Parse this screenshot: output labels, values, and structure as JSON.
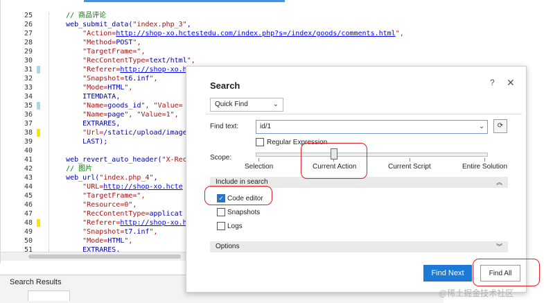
{
  "editor": {
    "lines": [
      {
        "n": "25",
        "mark": "none",
        "segs": [
          {
            "t": "    ",
            "c": "k"
          },
          {
            "t": "// 商品评论",
            "c": "c"
          }
        ]
      },
      {
        "n": "26",
        "mark": "none",
        "segs": [
          {
            "t": "    web_submit_data(",
            "c": "k"
          },
          {
            "t": "\"index.php_3\"",
            "c": "s"
          },
          {
            "t": ",",
            "c": "k"
          }
        ]
      },
      {
        "n": "27",
        "mark": "none",
        "segs": [
          {
            "t": "        \"Action=",
            "c": "s"
          },
          {
            "t": "http://shop-xo.hctestedu.com/index.php?s=/index/goods/comments.html",
            "c": "u"
          },
          {
            "t": "\",",
            "c": "s"
          }
        ]
      },
      {
        "n": "28",
        "mark": "none",
        "segs": [
          {
            "t": "        \"Method=",
            "c": "s"
          },
          {
            "t": "POST",
            "c": "k"
          },
          {
            "t": "\",",
            "c": "s"
          }
        ]
      },
      {
        "n": "29",
        "mark": "none",
        "segs": [
          {
            "t": "        \"TargetFrame=\",",
            "c": "s"
          }
        ]
      },
      {
        "n": "30",
        "mark": "none",
        "segs": [
          {
            "t": "        \"RecContentType=",
            "c": "s"
          },
          {
            "t": "text/html",
            "c": "k"
          },
          {
            "t": "\",",
            "c": "s"
          }
        ]
      },
      {
        "n": "31",
        "mark": "cyan",
        "segs": [
          {
            "t": "        \"Referer=",
            "c": "s"
          },
          {
            "t": "http://shop-xo.h",
            "c": "u"
          }
        ]
      },
      {
        "n": "32",
        "mark": "none",
        "segs": [
          {
            "t": "        \"Snapshot=",
            "c": "s"
          },
          {
            "t": "t6.inf",
            "c": "k"
          },
          {
            "t": "\",",
            "c": "s"
          }
        ]
      },
      {
        "n": "33",
        "mark": "none",
        "segs": [
          {
            "t": "        \"Mode=",
            "c": "s"
          },
          {
            "t": "HTML",
            "c": "k"
          },
          {
            "t": "\",",
            "c": "s"
          }
        ]
      },
      {
        "n": "34",
        "mark": "none",
        "segs": [
          {
            "t": "        ITEMDATA,",
            "c": "k"
          }
        ]
      },
      {
        "n": "35",
        "mark": "cyan",
        "segs": [
          {
            "t": "        \"Name=",
            "c": "s"
          },
          {
            "t": "goods_id",
            "c": "k"
          },
          {
            "t": "\", \"Value=",
            "c": "s"
          }
        ]
      },
      {
        "n": "36",
        "mark": "none",
        "segs": [
          {
            "t": "        \"Name=",
            "c": "s"
          },
          {
            "t": "page",
            "c": "k"
          },
          {
            "t": "\", \"Value=1\",",
            "c": "s"
          }
        ]
      },
      {
        "n": "37",
        "mark": "none",
        "segs": [
          {
            "t": "        EXTRARES,",
            "c": "k"
          }
        ]
      },
      {
        "n": "38",
        "mark": "yellow",
        "segs": [
          {
            "t": "        \"Url=",
            "c": "s"
          },
          {
            "t": "/static/upload/image",
            "c": "k"
          }
        ]
      },
      {
        "n": "39",
        "mark": "none",
        "segs": [
          {
            "t": "        LAST);",
            "c": "k"
          }
        ]
      },
      {
        "n": "40",
        "mark": "none",
        "segs": [
          {
            "t": "",
            "c": "k"
          }
        ]
      },
      {
        "n": "41",
        "mark": "none",
        "segs": [
          {
            "t": "    web_revert_auto_header(",
            "c": "k"
          },
          {
            "t": "\"X-Rec",
            "c": "s"
          }
        ]
      },
      {
        "n": "42",
        "mark": "none",
        "segs": [
          {
            "t": "    ",
            "c": "k"
          },
          {
            "t": "// 图片",
            "c": "c"
          }
        ]
      },
      {
        "n": "43",
        "mark": "none",
        "segs": [
          {
            "t": "    web_url(",
            "c": "k"
          },
          {
            "t": "\"index.php_4\"",
            "c": "s"
          },
          {
            "t": ",",
            "c": "k"
          }
        ]
      },
      {
        "n": "44",
        "mark": "none",
        "segs": [
          {
            "t": "        \"URL=",
            "c": "s"
          },
          {
            "t": "http://shop-xo.hcte",
            "c": "u"
          }
        ]
      },
      {
        "n": "45",
        "mark": "none",
        "segs": [
          {
            "t": "        \"TargetFrame=\",",
            "c": "s"
          }
        ]
      },
      {
        "n": "46",
        "mark": "none",
        "segs": [
          {
            "t": "        \"Resource=0\",",
            "c": "s"
          }
        ]
      },
      {
        "n": "47",
        "mark": "none",
        "segs": [
          {
            "t": "        \"RecContentType=",
            "c": "s"
          },
          {
            "t": "applicat",
            "c": "k"
          }
        ]
      },
      {
        "n": "48",
        "mark": "yellow",
        "segs": [
          {
            "t": "        \"Referer=",
            "c": "s"
          },
          {
            "t": "http://shop-xo.h",
            "c": "u"
          }
        ]
      },
      {
        "n": "49",
        "mark": "none",
        "segs": [
          {
            "t": "        \"Snapshot=",
            "c": "s"
          },
          {
            "t": "t7.inf",
            "c": "k"
          },
          {
            "t": "\",",
            "c": "s"
          }
        ]
      },
      {
        "n": "50",
        "mark": "none",
        "segs": [
          {
            "t": "        \"Mode=",
            "c": "s"
          },
          {
            "t": "HTML",
            "c": "k"
          },
          {
            "t": "\",",
            "c": "s"
          }
        ]
      },
      {
        "n": "51",
        "mark": "none",
        "segs": [
          {
            "t": "        EXTRARES,",
            "c": "k"
          }
        ]
      }
    ]
  },
  "results_panel": {
    "title": "Search Results"
  },
  "dialog": {
    "title": "Search",
    "help": "?",
    "close": "✕",
    "mode_select": "Quick Find",
    "find_label": "Find text:",
    "find_value": "id/1",
    "regex_label": "Regular Expression",
    "scope_label": "Scope:",
    "scope_options": [
      "Selection",
      "Current Action",
      "Current Script",
      "Entire Solution"
    ],
    "include_header": "Include in search",
    "include_items": [
      {
        "label": "Code editor",
        "checked": true
      },
      {
        "label": "Snapshots",
        "checked": false
      },
      {
        "label": "Logs",
        "checked": false
      }
    ],
    "options_header": "Options",
    "find_next": "Find Next",
    "find_all": "Find All"
  },
  "watermark": "@稀土掘金技术社区",
  "colors": {
    "accent": "#1c7ad4",
    "annotation": "#e02020"
  }
}
